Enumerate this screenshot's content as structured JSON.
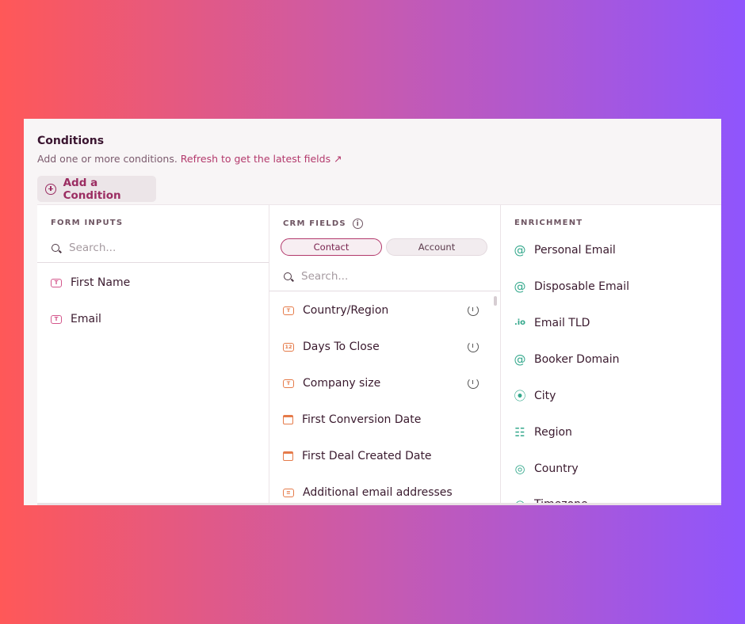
{
  "conditions": {
    "title": "Conditions",
    "subtitle": "Add one or more conditions.",
    "refresh_link": "Refresh to get the latest fields ↗",
    "add_button": "Add a Condition"
  },
  "form_inputs": {
    "header": "FORM INPUTS",
    "search_placeholder": "Search...",
    "items": [
      {
        "label": "First Name",
        "icon": "text-field-icon"
      },
      {
        "label": "Email",
        "icon": "text-field-icon"
      }
    ]
  },
  "crm_fields": {
    "header": "CRM FIELDS",
    "info": "i",
    "tabs": [
      {
        "label": "Contact",
        "active": true
      },
      {
        "label": "Account",
        "active": false
      }
    ],
    "search_placeholder": "Search...",
    "items": [
      {
        "label": "Country/Region",
        "icon": "text-field-icon",
        "icon_text": "T",
        "reset": true
      },
      {
        "label": "Days To Close",
        "icon": "number-field-icon",
        "icon_text": "12",
        "reset": true
      },
      {
        "label": "Company size",
        "icon": "text-field-icon",
        "icon_text": "T",
        "reset": true
      },
      {
        "label": "First Conversion Date",
        "icon": "calendar-icon",
        "reset": false
      },
      {
        "label": "First Deal Created Date",
        "icon": "calendar-icon",
        "reset": false
      },
      {
        "label": "Additional email addresses",
        "icon": "list-field-icon",
        "icon_text": "≡",
        "reset": false
      }
    ]
  },
  "enrichment": {
    "header": "ENRICHMENT",
    "items": [
      {
        "label": "Personal Email",
        "icon": "at-icon",
        "glyph": "@"
      },
      {
        "label": "Disposable Email",
        "icon": "at-icon",
        "glyph": "@"
      },
      {
        "label": "Email TLD",
        "icon": "tld-icon",
        "glyph": ".io"
      },
      {
        "label": "Booker Domain",
        "icon": "at-icon",
        "glyph": "@"
      },
      {
        "label": "City",
        "icon": "location-pin-icon",
        "glyph": "⦿"
      },
      {
        "label": "Region",
        "icon": "map-icon",
        "glyph": "☷"
      },
      {
        "label": "Country",
        "icon": "globe-icon",
        "glyph": "◎"
      },
      {
        "label": "Timezone",
        "icon": "globe-icon",
        "glyph": "◎"
      }
    ]
  },
  "colors": {
    "accent": "#b3396c",
    "orange": "#e57b4a",
    "teal": "#34a88c"
  }
}
